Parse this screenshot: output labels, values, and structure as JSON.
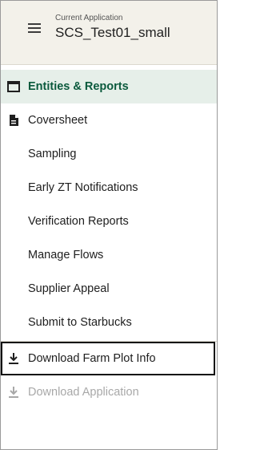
{
  "header": {
    "caption": "Current Application",
    "app_name": "SCS_Test01_small"
  },
  "nav": {
    "items": [
      {
        "label": "Entities & Reports",
        "icon": "window-icon",
        "active": true
      },
      {
        "label": "Coversheet",
        "icon": "document-icon"
      },
      {
        "label": "Sampling"
      },
      {
        "label": "Early ZT Notifications"
      },
      {
        "label": "Verification Reports"
      },
      {
        "label": "Manage Flows"
      },
      {
        "label": "Supplier Appeal"
      },
      {
        "label": "Submit to Starbucks"
      },
      {
        "label": "Download Farm Plot Info",
        "icon": "download-icon"
      },
      {
        "label": "Download Application",
        "icon": "download-icon",
        "disabled": true
      }
    ]
  },
  "colors": {
    "header_bg": "#f3f1ea",
    "active_bg": "#e6efe9",
    "active_text": "#0b5a3d",
    "disabled_text": "#a8a8a8"
  }
}
